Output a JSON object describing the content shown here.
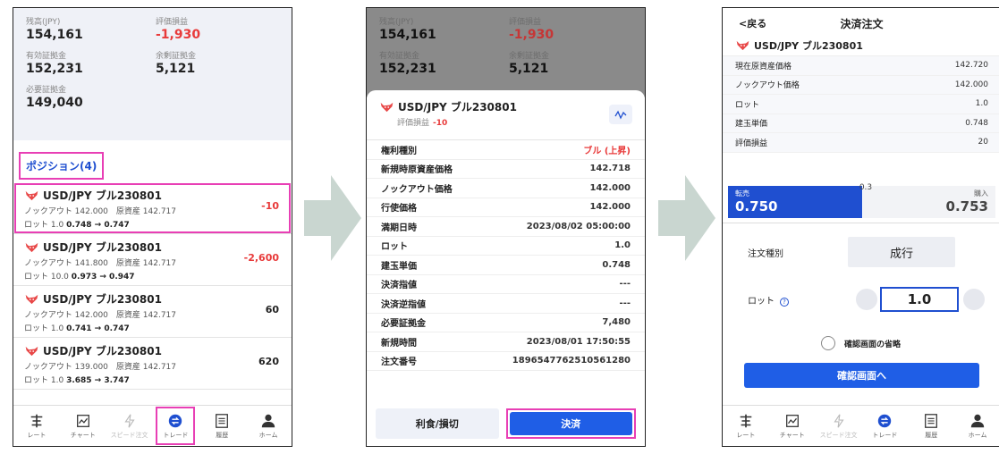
{
  "summary": {
    "balance_label": "残高(JPY)",
    "balance_value": "154,161",
    "unrealized_label": "評価損益",
    "unrealized_value": "-1,930",
    "effective_margin_label": "有効証拠金",
    "effective_margin_value": "152,231",
    "surplus_margin_label": "余剰証拠金",
    "surplus_margin_value": "5,121",
    "required_margin_label": "必要証拠金",
    "required_margin_value": "149,040"
  },
  "positions": {
    "title": "ポジション(4)",
    "items": [
      {
        "name": "USD/JPY ブル230801",
        "knockout": "ノックアウト 142.000",
        "underlying": "原資産 142.717",
        "lot": "ロット 1.0",
        "prices": "0.748 → 0.747",
        "pl": "-10"
      },
      {
        "name": "USD/JPY ブル230801",
        "knockout": "ノックアウト 141.800",
        "underlying": "原資産 142.717",
        "lot": "ロット 10.0",
        "prices": "0.973 → 0.947",
        "pl": "-2,600"
      },
      {
        "name": "USD/JPY ブル230801",
        "knockout": "ノックアウト 142.000",
        "underlying": "原資産 142.717",
        "lot": "ロット 1.0",
        "prices": "0.741 → 0.747",
        "pl": "60"
      },
      {
        "name": "USD/JPY ブル230801",
        "knockout": "ノックアウト 139.000",
        "underlying": "原資産 142.717",
        "lot": "ロット 1.0",
        "prices": "3.685 → 3.747",
        "pl": "620"
      }
    ]
  },
  "tabs": [
    "レート",
    "チャート",
    "スピード注文",
    "トレード",
    "履歴",
    "ホーム"
  ],
  "detail": {
    "name": "USD/JPY ブル230801",
    "pl_label": "評価損益",
    "pl_value": "-10",
    "rows": [
      {
        "k": "権利種別",
        "v": "ブル (上昇)"
      },
      {
        "k": "新規時原資産価格",
        "v": "142.718"
      },
      {
        "k": "ノックアウト価格",
        "v": "142.000"
      },
      {
        "k": "行使価格",
        "v": "142.000"
      },
      {
        "k": "満期日時",
        "v": "2023/08/02 05:00:00"
      },
      {
        "k": "ロット",
        "v": "1.0"
      },
      {
        "k": "建玉単価",
        "v": "0.748"
      },
      {
        "k": "決済指値",
        "v": "---"
      },
      {
        "k": "決済逆指値",
        "v": "---"
      },
      {
        "k": "必要証拠金",
        "v": "7,480"
      },
      {
        "k": "新規時間",
        "v": "2023/08/01 17:50:55"
      },
      {
        "k": "注文番号",
        "v": "1896547762510561280"
      }
    ],
    "tp_sl_button": "利食/損切",
    "settle_button": "決済"
  },
  "order": {
    "back": "<戻る",
    "title": "決済注文",
    "symbol": "USD/JPY ブル230801",
    "info": [
      {
        "k": "現在原資産価格",
        "v": "142.720"
      },
      {
        "k": "ノックアウト価格",
        "v": "142.000"
      },
      {
        "k": "ロット",
        "v": "1.0"
      },
      {
        "k": "建玉単価",
        "v": "0.748"
      },
      {
        "k": "評価損益",
        "v": "20"
      }
    ],
    "sell_label": "転売",
    "sell_price": "0.750",
    "spread": "0.3",
    "buy_label": "購入",
    "buy_price": "0.753",
    "order_type_label": "注文種別",
    "order_type_value": "成行",
    "lot_label": "ロット",
    "lot_value": "1.0",
    "skip_confirm_label": "確認画面の省略",
    "confirm_button": "確認画面へ"
  },
  "colors": {
    "highlight": "#e83fb5",
    "primary_blue": "#1f5ee6",
    "negative": "#e83a3a",
    "arrow": "#c9d6d0"
  }
}
